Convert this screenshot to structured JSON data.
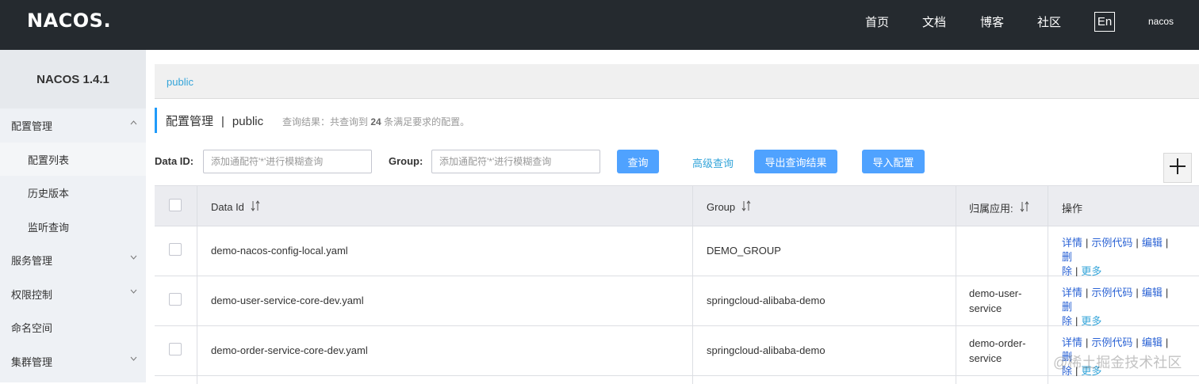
{
  "topbar": {
    "logo": "NACOS.",
    "nav": [
      "首页",
      "文档",
      "博客",
      "社区"
    ],
    "lang": "En",
    "user": "nacos"
  },
  "sidebar": {
    "version": "NACOS 1.4.1",
    "items": [
      {
        "label": "配置管理"
      },
      {
        "label": "配置列表"
      },
      {
        "label": "历史版本"
      },
      {
        "label": "监听查询"
      },
      {
        "label": "服务管理"
      },
      {
        "label": "权限控制"
      },
      {
        "label": "命名空间"
      },
      {
        "label": "集群管理"
      }
    ]
  },
  "breadcrumb": {
    "namespace": "public"
  },
  "title": {
    "section": "配置管理",
    "separator": "|",
    "namespace": "public"
  },
  "query_result": {
    "prefix": "查询结果：共查询到",
    "count": "24",
    "suffix": "条满足要求的配置。"
  },
  "filters": {
    "data_id_label": "Data ID:",
    "data_id_placeholder": "添加通配符'*'进行模糊查询",
    "group_label": "Group:",
    "group_placeholder": "添加通配符'*'进行模糊查询",
    "search": "查询",
    "advanced": "高级查询",
    "export": "导出查询结果",
    "import": "导入配置"
  },
  "table": {
    "headers": {
      "data_id": "Data Id",
      "group": "Group",
      "app": "归属应用:",
      "ops": "操作"
    },
    "ops_labels": {
      "detail": "详情",
      "sample": "示例代码",
      "edit": "编辑",
      "delete_1": "删",
      "delete_2": "除",
      "more": "更多",
      "sep": "|"
    },
    "rows": [
      {
        "data_id": "demo-nacos-config-local.yaml",
        "group": "DEMO_GROUP",
        "app": ""
      },
      {
        "data_id": "demo-user-service-core-dev.yaml",
        "group": "springcloud-alibaba-demo",
        "app": "demo-user-service"
      },
      {
        "data_id": "demo-order-service-core-dev.yaml",
        "group": "springcloud-alibaba-demo",
        "app": "demo-order-service"
      }
    ]
  },
  "watermark": "@稀土掘金技术社区"
}
